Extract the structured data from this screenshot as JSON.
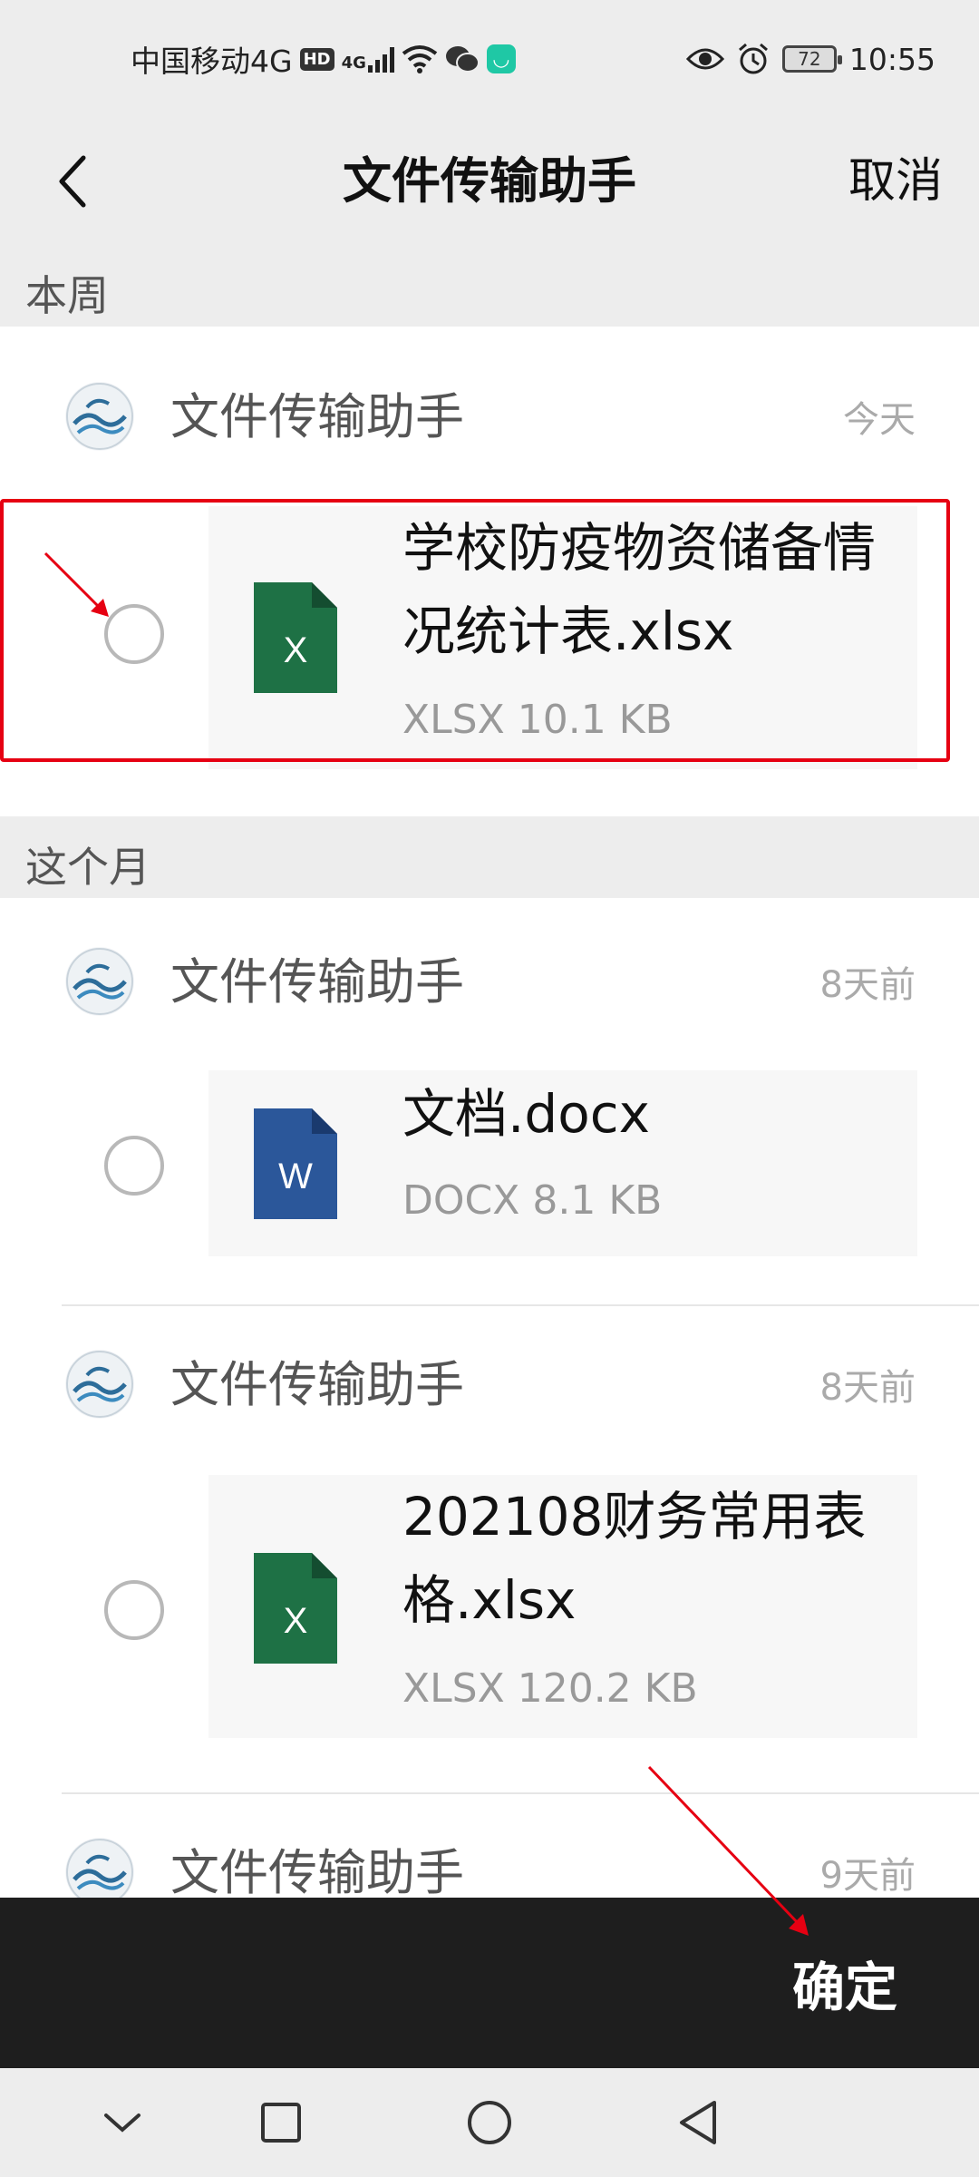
{
  "status_bar": {
    "carrier": "中国移动4G",
    "hd": "HD",
    "signal_label": "4G",
    "battery": "72",
    "time": "10:55"
  },
  "header": {
    "title": "文件传输助手",
    "cancel_label": "取消"
  },
  "sections": [
    {
      "title": "本周",
      "groups": [
        {
          "sender": "文件传输助手",
          "time": "今天",
          "file": {
            "name": "学校防疫物资储备情况统计表.xlsx",
            "meta": "XLSX 10.1 KB",
            "icon": "xlsx-file-icon",
            "icon_letter": "X",
            "color": "#1e7145"
          }
        }
      ]
    },
    {
      "title": "这个月",
      "groups": [
        {
          "sender": "文件传输助手",
          "time": "8天前",
          "file": {
            "name": "文档.docx",
            "meta": "DOCX 8.1 KB",
            "icon": "docx-file-icon",
            "icon_letter": "W",
            "color": "#2b579a"
          }
        },
        {
          "sender": "文件传输助手",
          "time": "8天前",
          "file": {
            "name": "202108财务常用表格.xlsx",
            "meta": "XLSX 120.2 KB",
            "icon": "xlsx-file-icon",
            "icon_letter": "X",
            "color": "#1e7145"
          }
        },
        {
          "sender": "文件传输助手",
          "time": "9天前"
        }
      ]
    }
  ],
  "footer": {
    "confirm_label": "确定"
  },
  "colors": {
    "accent_red": "#e60012",
    "bottom_bar": "#1e1e1e",
    "excel_green": "#1e7145",
    "word_blue": "#2b579a"
  }
}
